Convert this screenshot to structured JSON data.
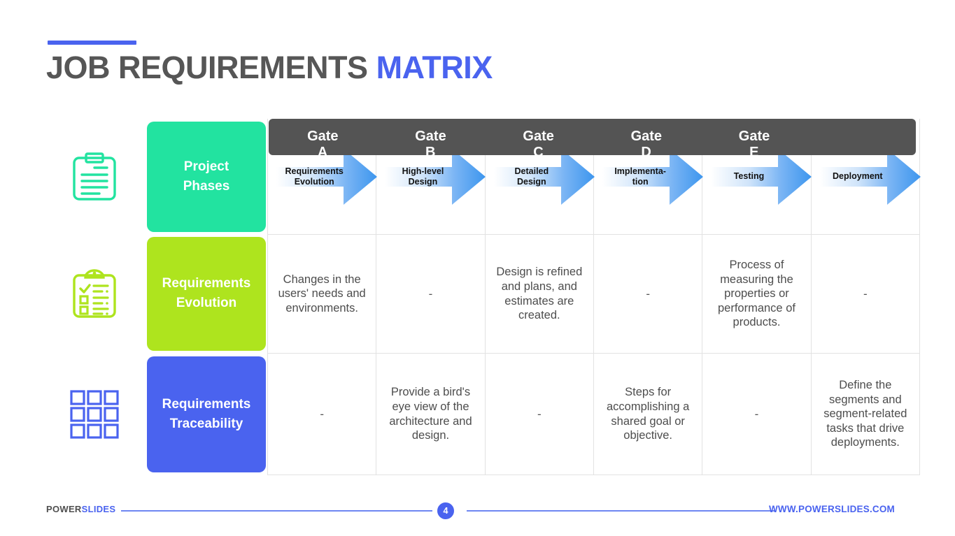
{
  "title": {
    "main": "JOB REQUIREMENTS",
    "accent": "MATRIX"
  },
  "colors": {
    "accent_blue": "#4a63ef",
    "title_gray": "#565656",
    "header_bar": "#545454",
    "row1_block": "#22e3a0",
    "row2_block": "#aee41e",
    "row3_block": "#4a63ef",
    "arrow_blue": "#3d96ee"
  },
  "table": {
    "headers": [
      "Gate A",
      "Gate B",
      "Gate C",
      "Gate D",
      "Gate E",
      ""
    ],
    "rows": [
      {
        "icon": "clipboard-icon",
        "label": "Project\nPhases",
        "block_color": "#22e3a0",
        "type": "arrows",
        "cells": [
          "Requirements\nEvolution",
          "High-level\nDesign",
          "Detailed\nDesign",
          "Implementa-\ntion",
          "Testing",
          "Deployment"
        ]
      },
      {
        "icon": "checklist-clipboard-icon",
        "label": "Requirements\nEvolution",
        "block_color": "#aee41e",
        "type": "text",
        "cells": [
          "Changes in the users' needs and environments.",
          "-",
          "Design is refined and plans, and estimates are created.",
          "-",
          "Process of measuring the properties or performance of products.",
          "-"
        ]
      },
      {
        "icon": "grid-squares-icon",
        "label": "Requirements\nTraceability",
        "block_color": "#4a63ef",
        "type": "text",
        "cells": [
          "-",
          "Provide a bird's eye view of the architecture and design.",
          "-",
          "Steps for accomplishing a shared goal or objective.",
          "-",
          "Define the segments and segment-related tasks that drive deployments."
        ]
      }
    ]
  },
  "footer": {
    "brand_dark": "POWER",
    "brand_blue": "SLIDES",
    "page_number": "4",
    "website": "WWW.POWERSLIDES.COM"
  }
}
